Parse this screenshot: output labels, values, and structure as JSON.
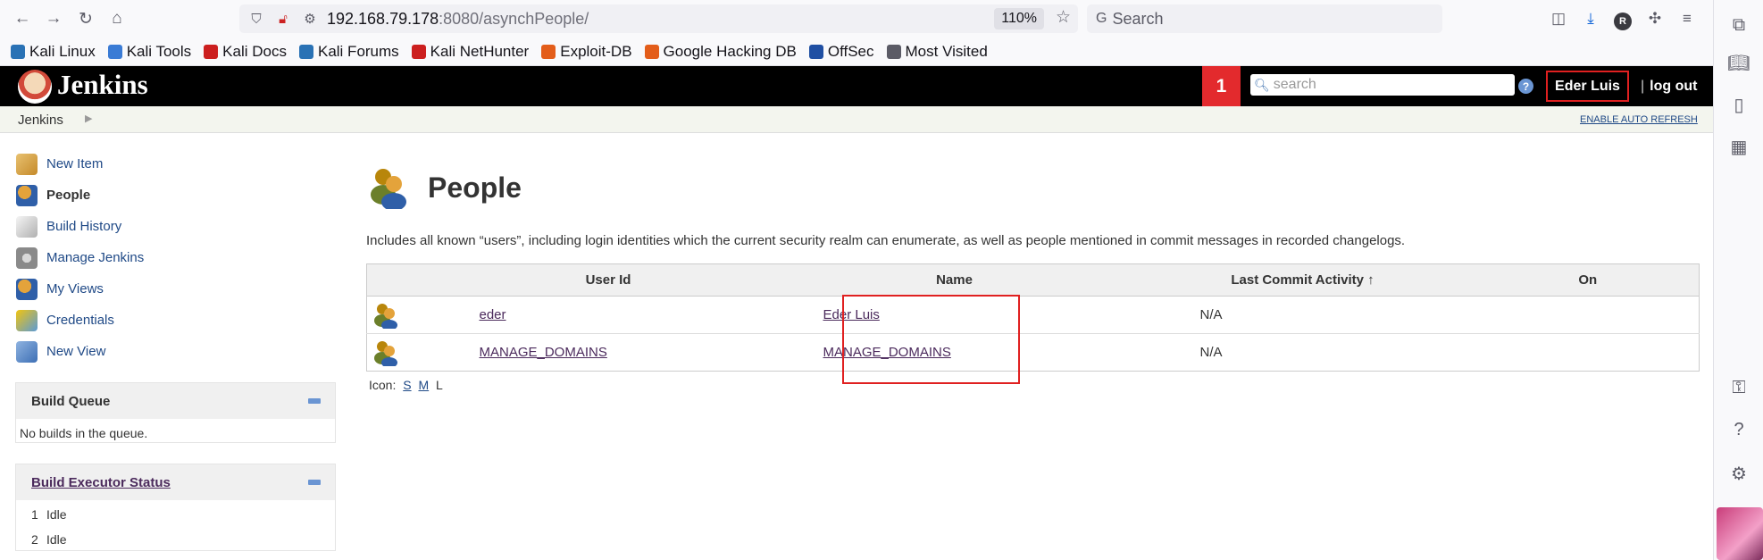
{
  "browser": {
    "url_host": "192.168.79.178",
    "url_path": ":8080/asynchPeople/",
    "zoom": "110%",
    "search_placeholder": "Search",
    "profile_initial": "R"
  },
  "bookmarks": [
    {
      "label": "Kali Linux",
      "color": "#2a72b5"
    },
    {
      "label": "Kali Tools",
      "color": "#3a7bd5"
    },
    {
      "label": "Kali Docs",
      "color": "#cc1f1f"
    },
    {
      "label": "Kali Forums",
      "color": "#2a72b5"
    },
    {
      "label": "Kali NetHunter",
      "color": "#cc1f1f"
    },
    {
      "label": "Exploit-DB",
      "color": "#e35d1a"
    },
    {
      "label": "Google Hacking DB",
      "color": "#e35d1a"
    },
    {
      "label": "OffSec",
      "color": "#1f4fa3"
    },
    {
      "label": "Most Visited",
      "color": "#5b5b66"
    }
  ],
  "jenkins": {
    "title": "Jenkins",
    "notification_count": "1",
    "search_placeholder": "search",
    "user": "Eder Luis",
    "logout": "log out",
    "separator": "|",
    "breadcrumb": "Jenkins",
    "auto_refresh": "ENABLE AUTO REFRESH"
  },
  "tasks": [
    {
      "label": "New Item",
      "icon": "new-item-icon",
      "active": false
    },
    {
      "label": "People",
      "icon": "people-icon",
      "active": true
    },
    {
      "label": "Build History",
      "icon": "build-history-icon",
      "active": false
    },
    {
      "label": "Manage Jenkins",
      "icon": "gear-icon",
      "active": false
    },
    {
      "label": "My Views",
      "icon": "people-icon",
      "active": false
    },
    {
      "label": "Credentials",
      "icon": "credentials-icon",
      "active": false
    },
    {
      "label": "New View",
      "icon": "folder-icon",
      "active": false
    }
  ],
  "build_queue": {
    "title": "Build Queue",
    "empty_text": "No builds in the queue."
  },
  "executors": {
    "title": "Build Executor Status",
    "rows": [
      {
        "num": "1",
        "status": "Idle"
      },
      {
        "num": "2",
        "status": "Idle"
      }
    ]
  },
  "main": {
    "title": "People",
    "description": "Includes all known “users”, including login identities which the current security realm can enumerate, as well as people mentioned in commit messages in recorded changelogs.",
    "columns": [
      "User Id",
      "Name",
      "Last Commit Activity  ↑",
      "On"
    ],
    "rows": [
      {
        "user_id": "eder",
        "name": "Eder Luis",
        "last_commit": "N/A",
        "on": ""
      },
      {
        "user_id": "MANAGE_DOMAINS",
        "name": "MANAGE_DOMAINS",
        "last_commit": "N/A",
        "on": ""
      }
    ],
    "icon_label": "Icon:",
    "icon_sizes": [
      "S",
      "M",
      "L"
    ]
  },
  "colors": {
    "jenkins_header": "#000000",
    "notification": "#e32a2d",
    "link": "#204a87",
    "visited_link": "#4b2a5c",
    "highlight_box": "#e02020"
  }
}
